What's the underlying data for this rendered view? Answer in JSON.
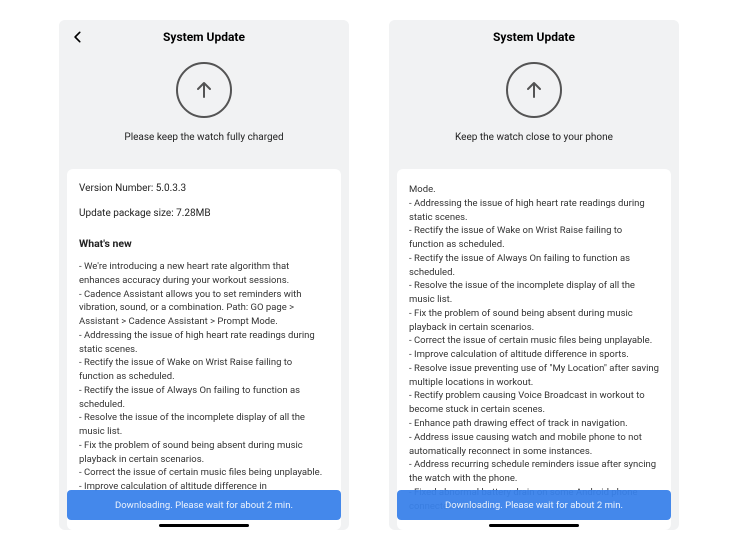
{
  "screens": [
    {
      "title": "System Update",
      "subtitle": "Please keep the watch fully charged",
      "version_label": "Version Number: 5.0.3.3",
      "package_label": "Update package size: 7.28MB",
      "whats_new_label": "What's new",
      "notes": [
        "We're introducing a new heart rate algorithm that enhances accuracy during your workout sessions.",
        "Cadence Assistant allows you to set reminders with vibration, sound, or a combination.  Path: GO page > Assistant > Cadence Assistant > Prompt Mode.",
        "Addressing the issue of high heart rate readings during static scenes.",
        "Rectify the issue of Wake on Wrist Raise failing to function as scheduled.",
        "Rectify the issue of Always On failing to function as scheduled.",
        "Resolve the issue of the incomplete display of all the music list.",
        "Fix the problem of sound being absent during music playback in certain scenarios.",
        "Correct the issue of certain music files being unplayable.",
        "Improve calculation of altitude difference in"
      ],
      "download_text": "Downloading. Please wait for about 2 min.",
      "show_back": true,
      "show_version_block": true
    },
    {
      "title": "System Update",
      "subtitle": "Keep the watch close to your phone",
      "notes_prefix": "Mode.",
      "notes": [
        "Addressing the issue of high heart rate readings during static scenes.",
        "Rectify the issue of Wake on Wrist Raise failing to function as scheduled.",
        "Rectify the issue of Always On failing to function as scheduled.",
        "Resolve the issue of the incomplete display of all the music list.",
        "Fix the problem of sound being absent during music playback in certain scenarios.",
        "Correct the issue of certain music files being unplayable.",
        "Improve calculation of altitude difference in sports.",
        "Resolve issue preventing use of \"My Location\" after saving multiple locations in workout.",
        "Rectify problem causing Voice Broadcast in workout to become stuck in certain scenes.",
        "Enhance path drawing effect of track in navigation.",
        "Address issue causing watch and mobile phone to not automatically reconnect in some instances.",
        "Address recurring schedule reminders issue after syncing the watch with the phone.",
        "Fixed abnormal battery drain on some Android phone connected to watch."
      ],
      "download_text": "Downloading. Please wait for about 2 min.",
      "show_back": false,
      "show_version_block": false
    }
  ]
}
